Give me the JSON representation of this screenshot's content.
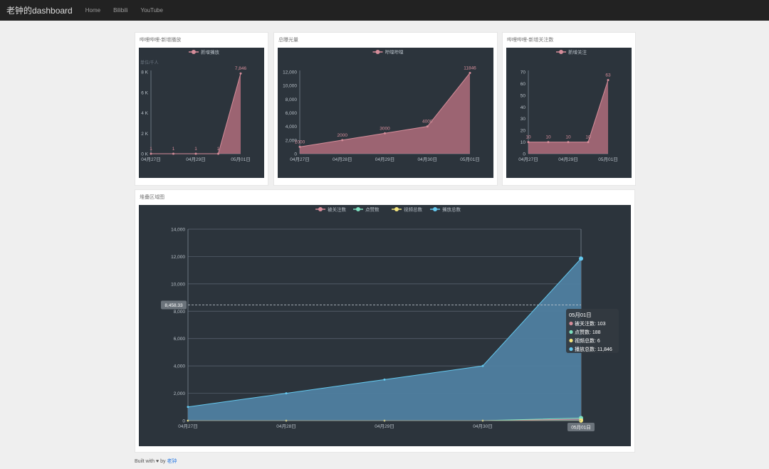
{
  "navbar": {
    "brand": "老钟的dashboard",
    "links": [
      "Home",
      "Bilibili",
      "YouTube"
    ]
  },
  "panels": [
    {
      "title": "哔哩哔哩-新增播放"
    },
    {
      "title": "总曝光量"
    },
    {
      "title": "哔哩哔哩-新增关注数"
    },
    {
      "title": "堆叠区域图"
    }
  ],
  "footer": {
    "prefix": "Built with",
    "heart": "♥",
    "by": "by",
    "author": "老钟"
  },
  "colors": {
    "pink": "#d68d9a",
    "blue": "#64c8ee",
    "blueFill": "#4f7fa0",
    "green": "#7ee0c0",
    "yellow": "#f5e67e",
    "bg": "#2c343c",
    "axis": "#7a8593",
    "text": "#b8c0c8"
  },
  "chart_data": [
    {
      "type": "area",
      "legend": "新增播放",
      "unit_label": "单位/千人",
      "x": [
        "04月27日",
        "04月28日",
        "04月29日",
        "04月30日",
        "05月01日"
      ],
      "x_tick_labels": [
        "04月27日",
        "04月29日",
        "05月01日"
      ],
      "series": [
        {
          "name": "新增播放",
          "values": [
            1,
            1,
            1,
            1,
            7846
          ]
        }
      ],
      "data_labels": [
        "1",
        "1",
        "1",
        "1",
        "7,846"
      ],
      "y_tick_labels": [
        "0 K",
        "2 K",
        "4 K",
        "6 K",
        "8 K"
      ],
      "ylim": [
        0,
        8000
      ]
    },
    {
      "type": "area",
      "legend": "哔哩哔哩",
      "x": [
        "04月27日",
        "04月28日",
        "04月29日",
        "04月30日",
        "05月01日"
      ],
      "x_tick_labels": [
        "04月27日",
        "04月28日",
        "04月29日",
        "04月30日",
        "05月01日"
      ],
      "series": [
        {
          "name": "哔哩哔哩",
          "values": [
            1000,
            2000,
            3000,
            4000,
            11846
          ]
        }
      ],
      "data_labels": [
        "1000",
        "2000",
        "3000",
        "4000",
        "11846"
      ],
      "y_tick_labels": [
        "0",
        "2,000",
        "4,000",
        "6,000",
        "8,000",
        "10,000",
        "12,000"
      ],
      "ylim": [
        0,
        12000
      ]
    },
    {
      "type": "area",
      "legend": "新增关注",
      "x": [
        "04月27日",
        "04月28日",
        "04月29日",
        "04月30日",
        "05月01日"
      ],
      "x_tick_labels": [
        "04月27日",
        "04月29日",
        "05月01日"
      ],
      "series": [
        {
          "name": "新增关注",
          "values": [
            10,
            10,
            10,
            10,
            63
          ]
        }
      ],
      "data_labels": [
        "10",
        "10",
        "10",
        "10",
        "63"
      ],
      "y_tick_labels": [
        "0",
        "10",
        "20",
        "30",
        "40",
        "50",
        "60",
        "70"
      ],
      "ylim": [
        0,
        70
      ]
    },
    {
      "type": "area",
      "x": [
        "04月27日",
        "04月28日",
        "04月29日",
        "04月30日",
        "05月01日"
      ],
      "x_tick_labels": [
        "04月27日",
        "04月28日",
        "04月29日",
        "04月30日",
        "05月01日"
      ],
      "series": [
        {
          "name": "被关注数",
          "values": [
            0,
            0,
            0,
            0,
            103
          ]
        },
        {
          "name": "点赞数",
          "values": [
            0,
            0,
            0,
            0,
            188
          ]
        },
        {
          "name": "视频总数",
          "values": [
            0,
            0,
            0,
            0,
            6
          ]
        },
        {
          "name": "播放总数",
          "values": [
            1000,
            2000,
            3000,
            4000,
            11846
          ]
        }
      ],
      "y_tick_labels": [
        "0",
        "2,000",
        "4,000",
        "6,000",
        "8,000",
        "10,000",
        "12,000",
        "14,000"
      ],
      "ylim": [
        0,
        14000
      ],
      "crosshair_label": "8,458.33",
      "crosshair_value": 8458.33,
      "x_pointer_label": "05月01日",
      "tooltip": {
        "title": "05月01日",
        "rows": [
          "被关注数: 103",
          "点赞数: 188",
          "视频总数: 6",
          "播放总数: 11,846"
        ]
      }
    }
  ]
}
